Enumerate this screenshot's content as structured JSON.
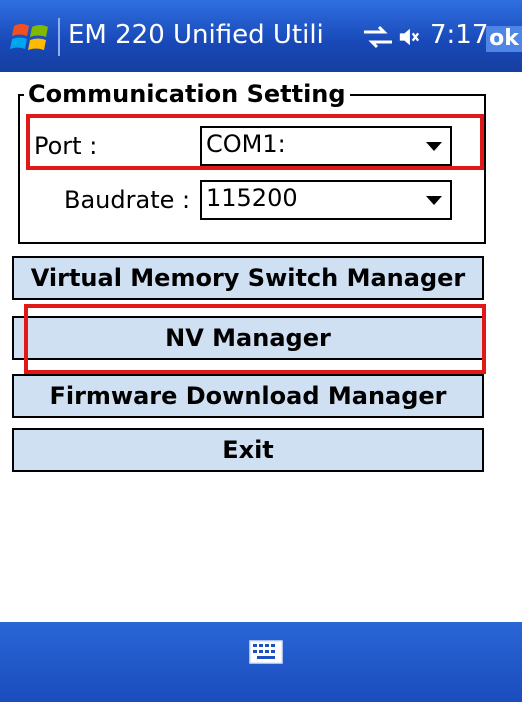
{
  "titlebar": {
    "title": "EM 220 Unified Utili",
    "time": "7:17",
    "ok_label": "ok",
    "volume_icon": "speaker-muted-icon"
  },
  "group": {
    "title": "Communication Setting",
    "port_label": "Port :",
    "port_value": "COM1:",
    "baud_label": "Baudrate :",
    "baud_value": "115200"
  },
  "buttons": {
    "vms": "Virtual Memory Switch Manager",
    "nv": "NV Manager",
    "firmware": "Firmware Download Manager",
    "exit": "Exit"
  },
  "colors": {
    "titlebar": "#1848b8",
    "button_bg": "#cfe0f3",
    "highlight": "#e01818"
  }
}
